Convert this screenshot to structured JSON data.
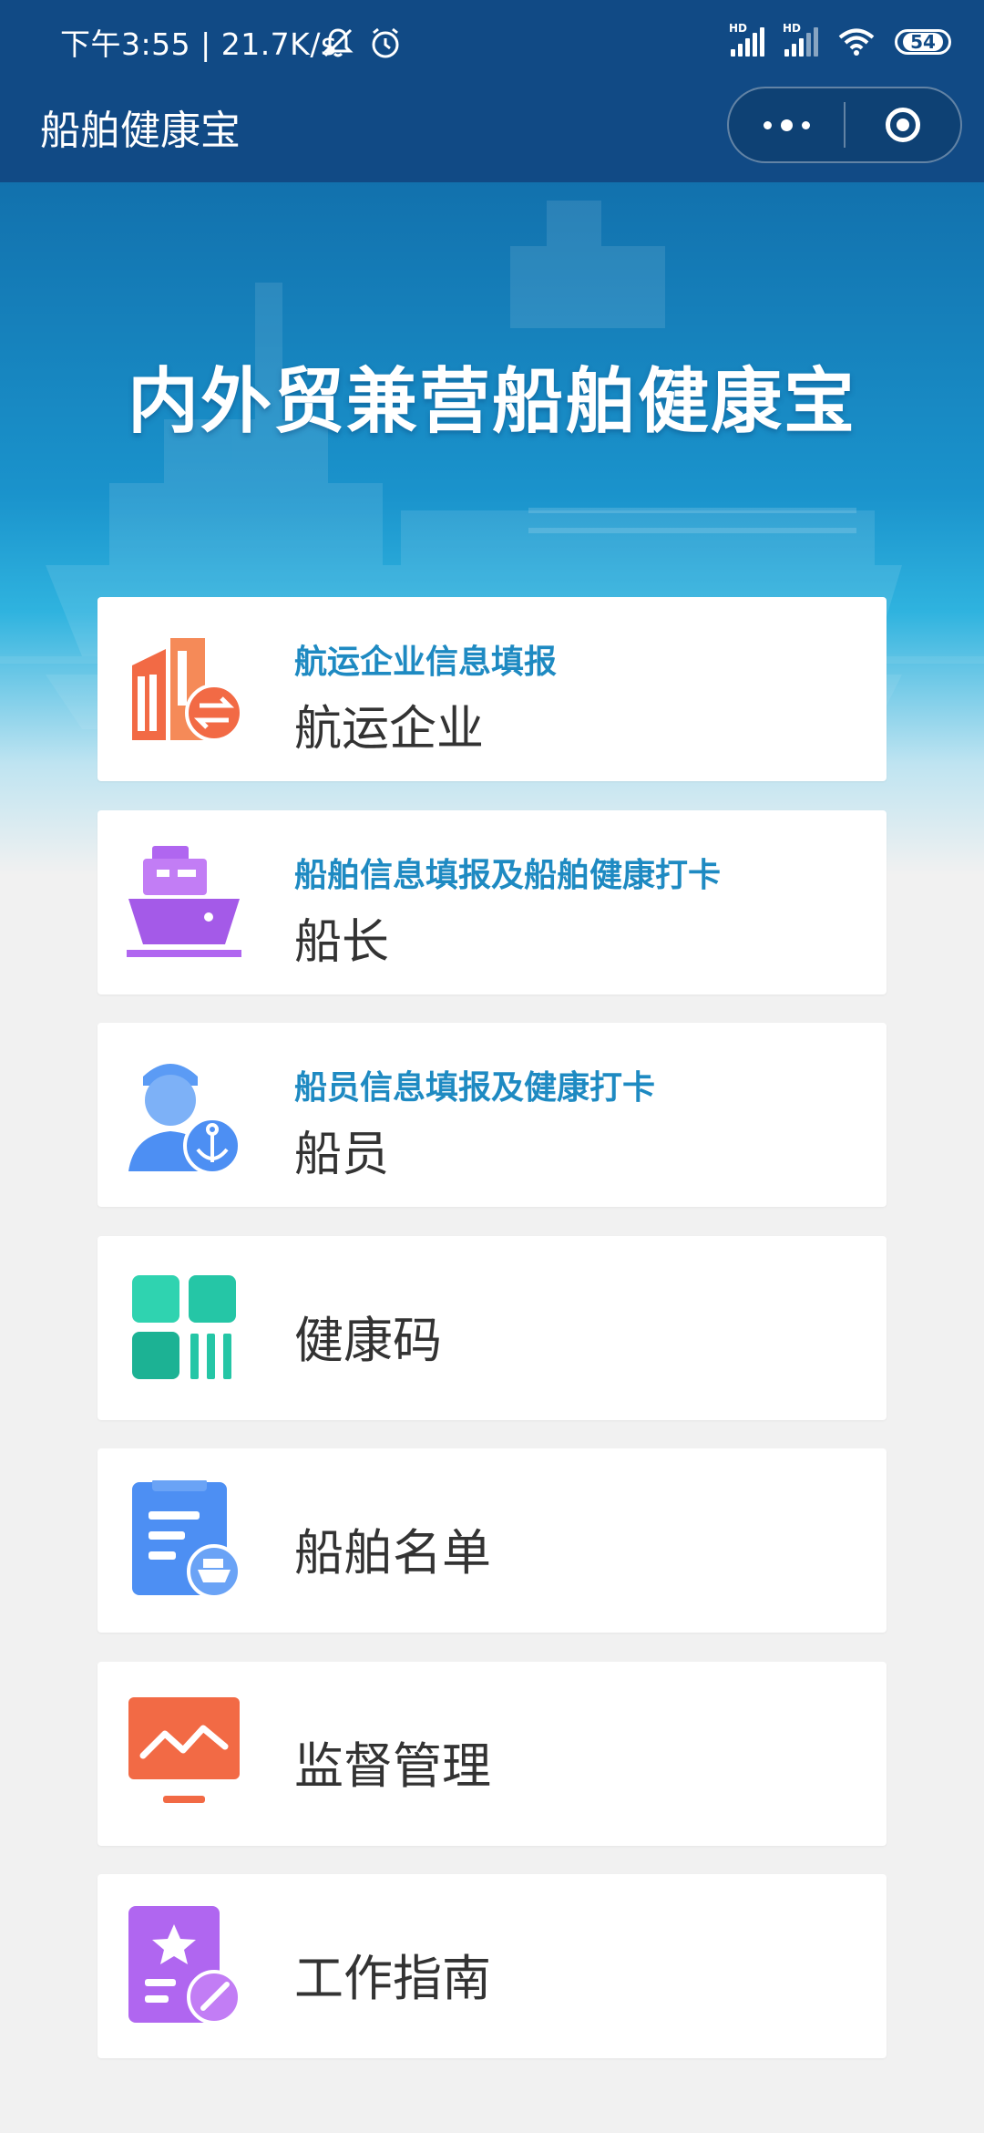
{
  "status_bar": {
    "time_speed": "下午3:55 | 21.7K/s",
    "battery": "54",
    "hd_label": "HD"
  },
  "title_bar": {
    "title": "船舶健康宝"
  },
  "banner": {
    "title": "内外贸兼营船舶健康宝"
  },
  "cards": [
    {
      "subtitle": "航运企业信息填报",
      "title": "航运企业",
      "icon": "building-exchange-icon"
    },
    {
      "subtitle": "船舶信息填报及船舶健康打卡",
      "title": "船长",
      "icon": "ship-icon"
    },
    {
      "subtitle": "船员信息填报及健康打卡",
      "title": "船员",
      "icon": "crew-anchor-icon"
    },
    {
      "title": "健康码",
      "icon": "health-code-icon"
    },
    {
      "title": "船舶名单",
      "icon": "ship-list-icon"
    },
    {
      "title": "监督管理",
      "icon": "monitor-chart-icon"
    },
    {
      "title": "工作指南",
      "icon": "guide-star-icon"
    }
  ],
  "colors": {
    "header": "#114a85",
    "subtitle": "#1e8ac2",
    "orange": "#f26a45",
    "purple": "#b066f0",
    "blue": "#4d8ff3",
    "teal": "#25c6a6"
  }
}
